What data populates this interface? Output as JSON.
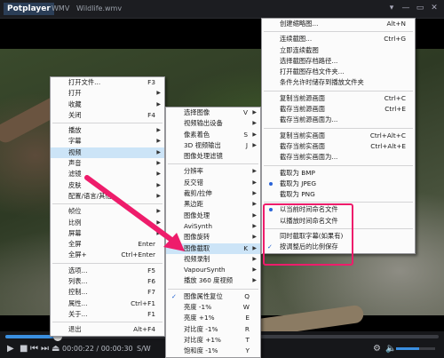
{
  "titlebar": {
    "app": "Potplayer",
    "tab1": "WMV",
    "tab2": "Wildlife.wmv",
    "buttons": [
      "▾",
      "—",
      "▭",
      "✕"
    ]
  },
  "controls": {
    "progress": 0.12,
    "time": "00:00:22 / 00:00:30",
    "subtitle_mode": "S/W",
    "volume": 0.6,
    "icons": [
      "play-icon",
      "stop-icon",
      "prev-icon",
      "next-icon",
      "eject-icon",
      "settings-icon"
    ]
  },
  "main_menu": {
    "items": [
      {
        "label": "打开文件...",
        "shortcut": "F3",
        "sub": false
      },
      {
        "label": "打开",
        "shortcut": "",
        "sub": true
      },
      {
        "label": "收藏",
        "shortcut": "",
        "sub": true
      },
      {
        "label": "关闭",
        "shortcut": "F4",
        "sub": false
      },
      {
        "sep": true
      },
      {
        "label": "播放",
        "shortcut": "",
        "sub": true
      },
      {
        "label": "字幕",
        "shortcut": "",
        "sub": true
      },
      {
        "label": "视频",
        "shortcut": "",
        "sub": true,
        "hl": true
      },
      {
        "label": "声音",
        "shortcut": "",
        "sub": true
      },
      {
        "label": "滤镜",
        "shortcut": "",
        "sub": true
      },
      {
        "label": "皮肤",
        "shortcut": "",
        "sub": true
      },
      {
        "label": "配置/语言/其他",
        "shortcut": "",
        "sub": true
      },
      {
        "sep": true
      },
      {
        "label": "帧位",
        "shortcut": "",
        "sub": true
      },
      {
        "label": "比例",
        "shortcut": "",
        "sub": true
      },
      {
        "label": "屏幕",
        "shortcut": "",
        "sub": true
      },
      {
        "label": "全屏",
        "shortcut": "Enter",
        "sub": false
      },
      {
        "label": "全屏+",
        "shortcut": "Ctrl+Enter",
        "sub": false
      },
      {
        "sep": true
      },
      {
        "label": "选项...",
        "shortcut": "F5",
        "sub": false
      },
      {
        "label": "列表...",
        "shortcut": "F6",
        "sub": false
      },
      {
        "label": "控制...",
        "shortcut": "F7",
        "sub": false
      },
      {
        "label": "属性...",
        "shortcut": "Ctrl+F1",
        "sub": false
      },
      {
        "label": "关于...",
        "shortcut": "F1",
        "sub": false
      },
      {
        "sep": true
      },
      {
        "label": "退出",
        "shortcut": "Alt+F4",
        "sub": false
      }
    ]
  },
  "video_menu": {
    "items": [
      {
        "label": "选择图像",
        "shortcut": "V",
        "sub": true
      },
      {
        "label": "视频输出设备",
        "shortcut": "",
        "sub": true
      },
      {
        "label": "像素着色",
        "shortcut": "S",
        "sub": true
      },
      {
        "label": "3D 视频输出",
        "shortcut": "J",
        "sub": true
      },
      {
        "label": "图像处理滤镜",
        "shortcut": "",
        "sub": false
      },
      {
        "sep": true
      },
      {
        "label": "分辨率",
        "shortcut": "",
        "sub": true
      },
      {
        "label": "反交错",
        "shortcut": "",
        "sub": true
      },
      {
        "label": "裁剪/拉伸",
        "shortcut": "",
        "sub": true
      },
      {
        "label": "黑边距",
        "shortcut": "",
        "sub": true
      },
      {
        "label": "图像处理",
        "shortcut": "",
        "sub": true
      },
      {
        "label": "AviSynth",
        "shortcut": "",
        "sub": true
      },
      {
        "label": "图像旋转",
        "shortcut": "",
        "sub": true
      },
      {
        "label": "图像截取",
        "shortcut": "K",
        "sub": true,
        "hl": true
      },
      {
        "label": "视频录制",
        "shortcut": "",
        "sub": true
      },
      {
        "label": "VapourSynth",
        "shortcut": "",
        "sub": true
      },
      {
        "label": "播放 360 度视频",
        "shortcut": "",
        "sub": true
      },
      {
        "sep": true
      },
      {
        "label": "图像属性复位",
        "shortcut": "Q",
        "sub": false,
        "check": true
      },
      {
        "label": "亮度 -1%",
        "shortcut": "W",
        "sub": false
      },
      {
        "label": "亮度 +1%",
        "shortcut": "E",
        "sub": false
      },
      {
        "label": "对比度 -1%",
        "shortcut": "R",
        "sub": false
      },
      {
        "label": "对比度 +1%",
        "shortcut": "T",
        "sub": false
      },
      {
        "label": "饱和度 -1%",
        "shortcut": "Y",
        "sub": false
      }
    ]
  },
  "capture_menu": {
    "items": [
      {
        "label": "创建缩略图...",
        "shortcut": "Alt+N"
      },
      {
        "sep": true
      },
      {
        "label": "连续截图...",
        "shortcut": "Ctrl+G"
      },
      {
        "label": "立即连续截图",
        "shortcut": ""
      },
      {
        "label": "选择截图存档路径...",
        "shortcut": ""
      },
      {
        "label": "打开截图存档文件夹...",
        "shortcut": ""
      },
      {
        "label": "条件允许时储存到播放文件夹",
        "shortcut": ""
      },
      {
        "sep": true
      },
      {
        "label": "复制当前源画面",
        "shortcut": "Ctrl+C"
      },
      {
        "label": "截存当前源画面",
        "shortcut": "Ctrl+E"
      },
      {
        "label": "截存当前源画面为...",
        "shortcut": ""
      },
      {
        "sep": true
      },
      {
        "label": "复制当前实画面",
        "shortcut": "Ctrl+Alt+C"
      },
      {
        "label": "截存当前实画面",
        "shortcut": "Ctrl+Alt+E"
      },
      {
        "label": "截存当前实画面为...",
        "shortcut": ""
      },
      {
        "sep": true
      },
      {
        "label": "截取为 BMP",
        "shortcut": ""
      },
      {
        "label": "截取为 JPEG",
        "shortcut": "",
        "radio": true
      },
      {
        "label": "截取为 PNG",
        "shortcut": ""
      },
      {
        "sep": true
      },
      {
        "label": "以当前时间命名文件",
        "shortcut": "",
        "radio": true
      },
      {
        "label": "以播放时间命名文件",
        "shortcut": ""
      },
      {
        "sep": true
      },
      {
        "label": "同时截取字幕(如果有)",
        "shortcut": ""
      },
      {
        "label": "按调整后的比例保存",
        "shortcut": "",
        "check": true
      }
    ]
  },
  "annotation": {
    "color": "#ee1c6b"
  }
}
